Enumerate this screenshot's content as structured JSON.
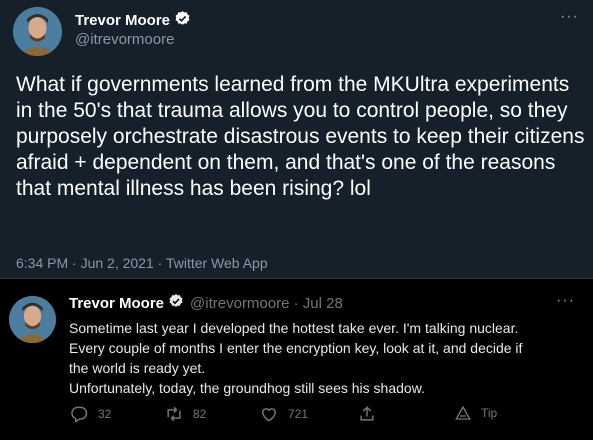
{
  "top_tweet": {
    "display_name": "Trevor Moore",
    "handle": "@itrevormoore",
    "text": "What if governments learned from the MKUltra experiments in the 50's that trauma allows you to control people, so they purposely orchestrate disastrous events to keep their citizens afraid + dependent on them, and that's one of the reasons that mental illness has been rising? lol",
    "meta": "6:34 PM · Jun 2, 2021 · Twitter Web App",
    "more_glyph": "···"
  },
  "bottom_tweet": {
    "display_name": "Trevor Moore",
    "handle_date": "@itrevormoore · Jul 28",
    "text_lines": [
      "Sometime last year I developed the hottest take ever. I'm talking nuclear.",
      "Every couple of months I enter the encryption key, look at it, and decide if",
      "the world is ready yet.",
      "Unfortunately, today, the groundhog still sees his shadow."
    ],
    "more_glyph": "···",
    "actions": {
      "reply_count": "32",
      "retweet_count": "82",
      "like_count": "721",
      "tip_label": "Tip"
    }
  },
  "colors": {
    "verified": "#1d9bf0",
    "top_background": "#15202b",
    "bottom_background": "#000000",
    "muted_text": "#8899a6"
  },
  "icons": [
    "avatar",
    "verified-badge-icon",
    "more-icon",
    "reply-icon",
    "retweet-icon",
    "like-icon",
    "share-icon",
    "tip-icon"
  ]
}
